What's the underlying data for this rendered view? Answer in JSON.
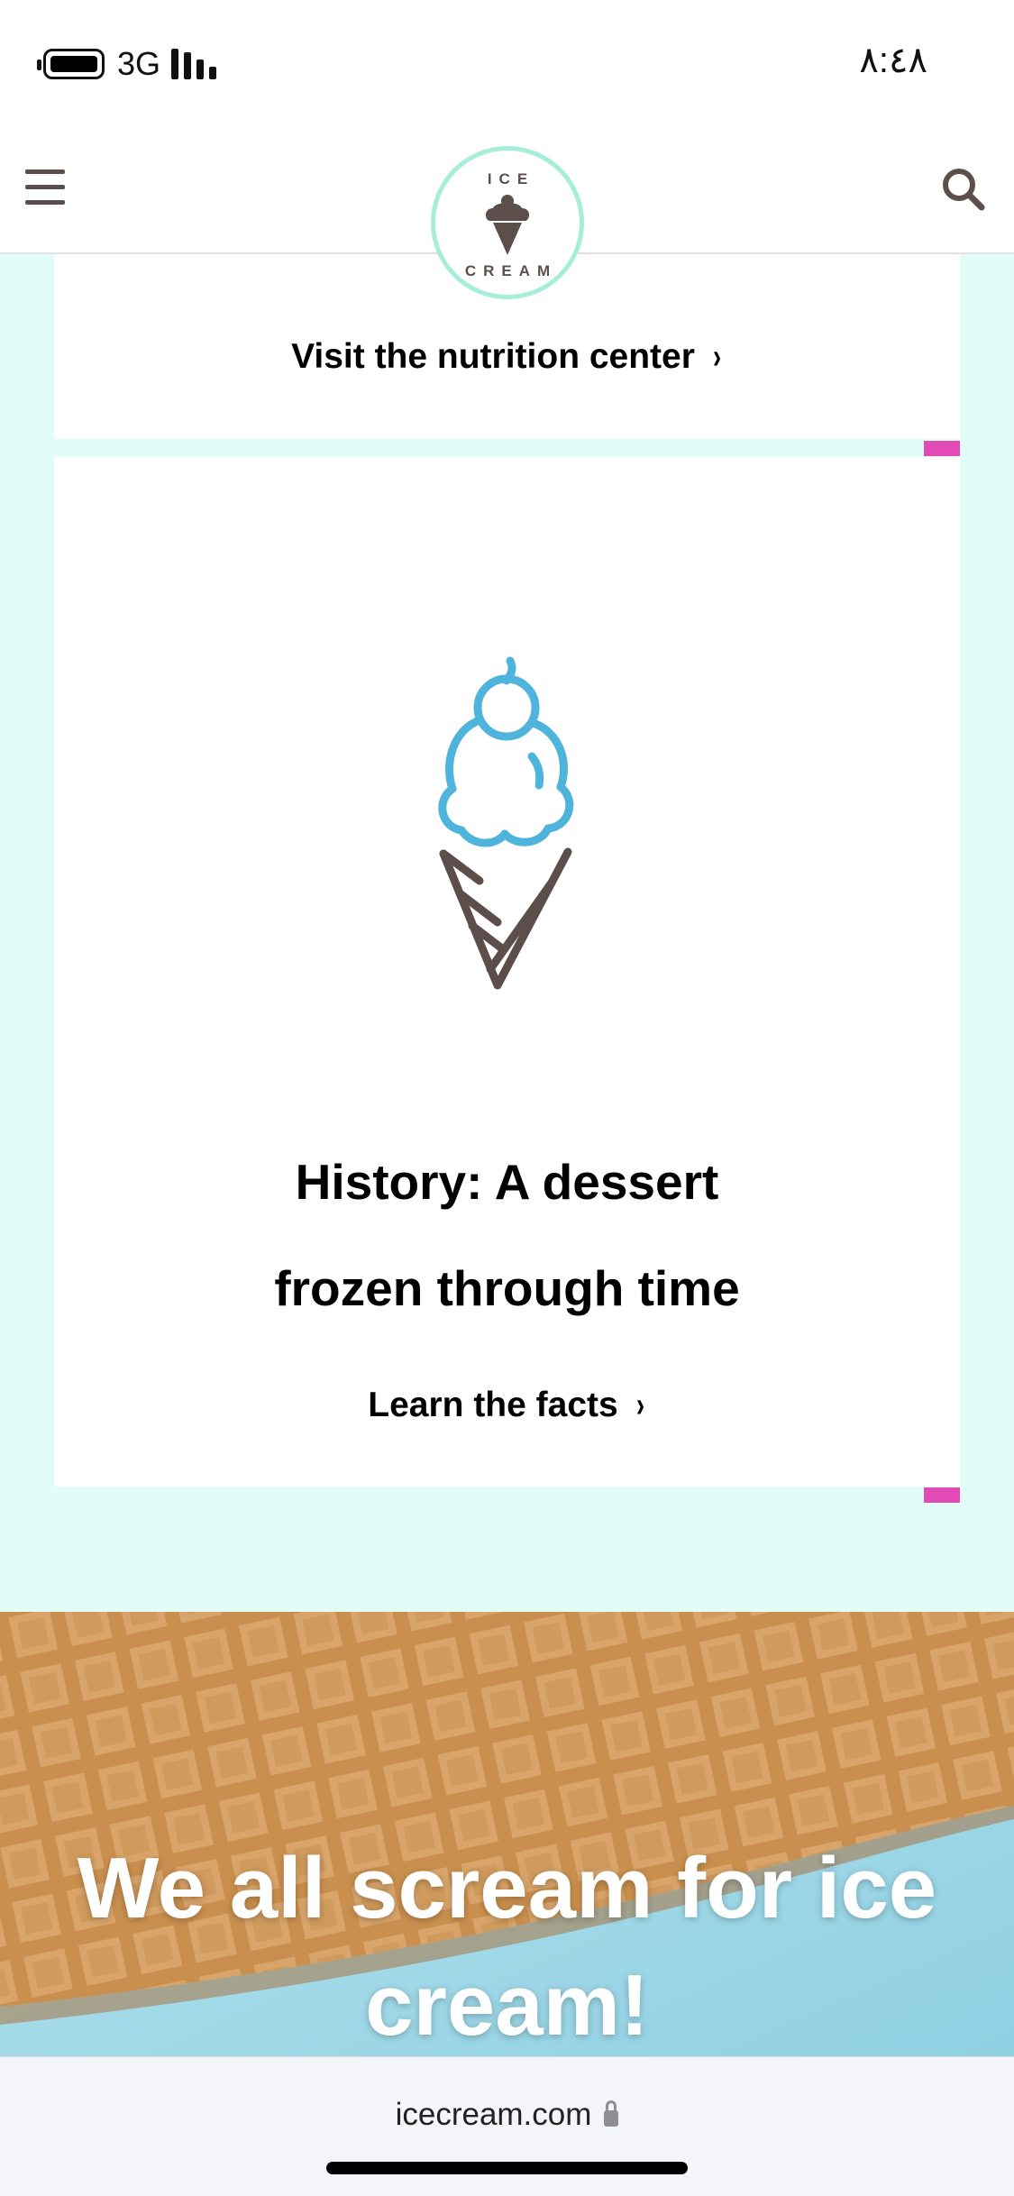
{
  "status_bar": {
    "network": "3G",
    "time": "٨:٤٨"
  },
  "header": {
    "logo_top": "ICE",
    "logo_bottom": "CREAM"
  },
  "cards": {
    "nutrition_link": "Visit the nutrition center",
    "history_title_line1": "History: A dessert",
    "history_title_line2": "frozen through time",
    "facts_link": "Learn the facts",
    "chevron": "›"
  },
  "banner": {
    "headline_line1": "We all scream for ice",
    "headline_line2": "cream!"
  },
  "browser": {
    "url": "icecream.com"
  },
  "colors": {
    "background": "#e2fdf8",
    "accent_pink": "#e24bb6",
    "scoop_blue": "#4fb4dc",
    "cone_brown": "#5c4f4b",
    "logo_ring": "#a6eed9"
  },
  "icons": [
    "battery-icon",
    "signal-icon",
    "menu-icon",
    "search-icon",
    "ice-cream-cone-icon",
    "lock-icon"
  ]
}
